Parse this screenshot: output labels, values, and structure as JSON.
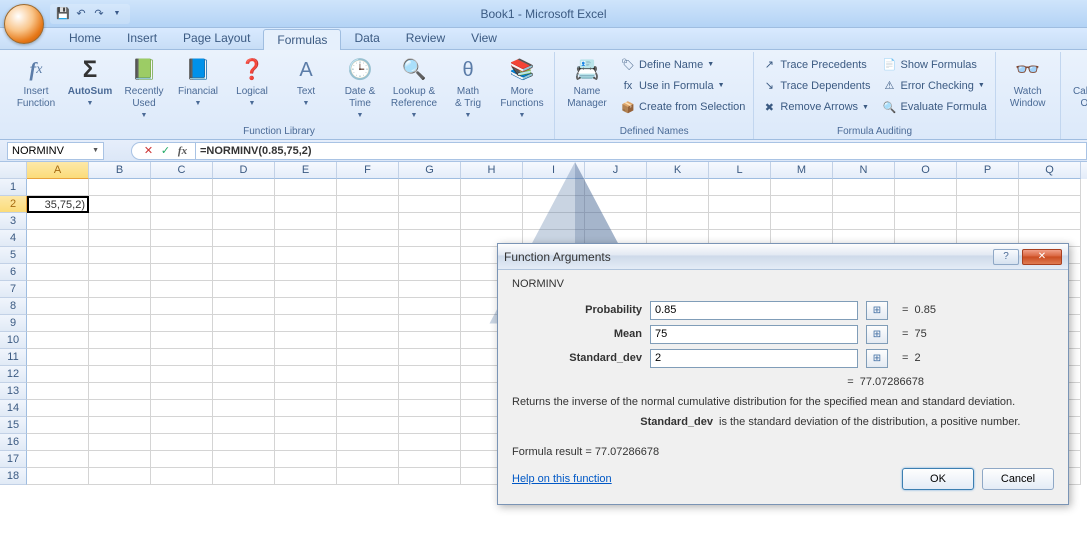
{
  "title": "Book1 - Microsoft Excel",
  "tabs": [
    "Home",
    "Insert",
    "Page Layout",
    "Formulas",
    "Data",
    "Review",
    "View"
  ],
  "active_tab": 3,
  "ribbon": {
    "library": {
      "title": "Function Library",
      "items": [
        {
          "label": "Insert\nFunction",
          "icon": "fx"
        },
        {
          "label": "AutoSum",
          "icon": "Σ",
          "dd": true,
          "bold": true
        },
        {
          "label": "Recently\nUsed",
          "icon": "📗",
          "dd": true
        },
        {
          "label": "Financial",
          "icon": "📘",
          "dd": true
        },
        {
          "label": "Logical",
          "icon": "❓",
          "dd": true
        },
        {
          "label": "Text",
          "icon": "A",
          "dd": true
        },
        {
          "label": "Date &\nTime",
          "icon": "🕒",
          "dd": true
        },
        {
          "label": "Lookup &\nReference",
          "icon": "🔍",
          "dd": true
        },
        {
          "label": "Math\n& Trig",
          "icon": "θ",
          "dd": true
        },
        {
          "label": "More\nFunctions",
          "icon": "📚",
          "dd": true
        }
      ]
    },
    "defined": {
      "title": "Defined Names",
      "big": {
        "label": "Name\nManager",
        "icon": "📇"
      },
      "small": [
        "Define Name",
        "Use in Formula",
        "Create from Selection"
      ]
    },
    "audit": {
      "title": "Formula Auditing",
      "left": [
        "Trace Precedents",
        "Trace Dependents",
        "Remove Arrows"
      ],
      "right": [
        "Show Formulas",
        "Error Checking",
        "Evaluate Formula"
      ]
    },
    "watch": {
      "label": "Watch\nWindow",
      "icon": "👓"
    },
    "calc": {
      "label": "Calculation\nOptions",
      "icon": "🗒",
      "dd": true
    }
  },
  "namebox": "NORMINV",
  "formula": "=NORMINV(0.85,75,2)",
  "cols": [
    "A",
    "B",
    "C",
    "D",
    "E",
    "F",
    "G",
    "H",
    "I",
    "J",
    "K",
    "L",
    "M",
    "N",
    "O",
    "P",
    "Q"
  ],
  "rows": 18,
  "active_cell": {
    "row": 2,
    "col": 0,
    "display": "35,75,2)"
  },
  "dialog": {
    "title": "Function Arguments",
    "func": "NORMINV",
    "args": [
      {
        "label": "Probability",
        "value": "0.85",
        "res": "0.85"
      },
      {
        "label": "Mean",
        "value": "75",
        "res": "75"
      },
      {
        "label": "Standard_dev",
        "value": "2",
        "res": "2"
      }
    ],
    "result": "77.07286678",
    "desc": "Returns the inverse of the normal cumulative distribution for the specified mean and standard deviation.",
    "arg_desc_label": "Standard_dev",
    "arg_desc_text": "is the standard deviation of the distribution, a positive number.",
    "formula_result_label": "Formula result = ",
    "help": "Help on this function",
    "ok": "OK",
    "cancel": "Cancel"
  }
}
